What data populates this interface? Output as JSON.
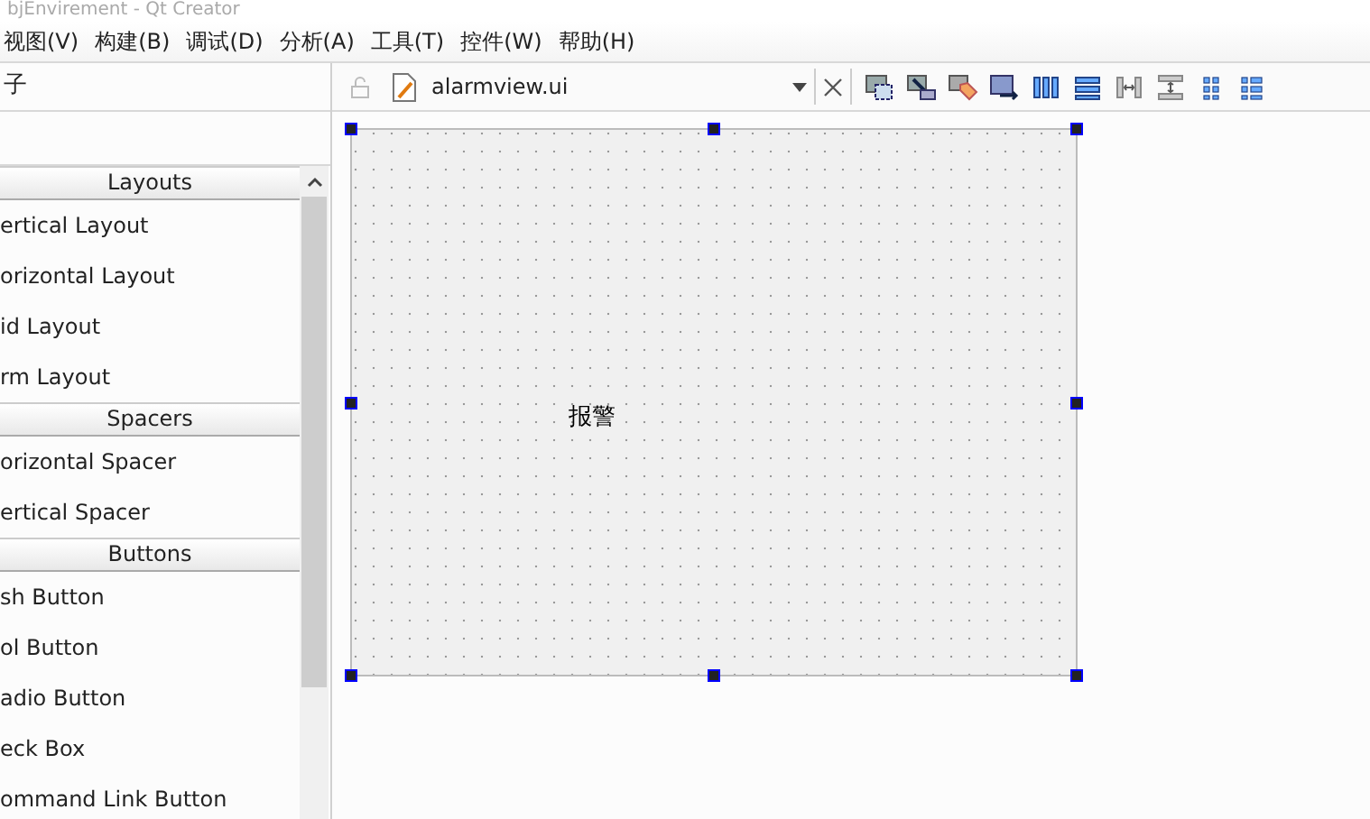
{
  "window": {
    "title": "bjEnvirement - Qt Creator"
  },
  "menu": [
    "视图(V)",
    "构建(B)",
    "调试(D)",
    "分析(A)",
    "工具(T)",
    "控件(W)",
    "帮助(H)"
  ],
  "widget_box": {
    "title": "子",
    "groups": [
      {
        "name": "Layouts",
        "items": [
          "ertical Layout",
          "orizontal Layout",
          "id Layout",
          "rm Layout"
        ]
      },
      {
        "name": "Spacers",
        "items": [
          "orizontal Spacer",
          "ertical Spacer"
        ]
      },
      {
        "name": "Buttons",
        "items": [
          "sh Button",
          "ol Button",
          "adio Button",
          "eck Box",
          "ommand Link Button"
        ]
      }
    ]
  },
  "editor": {
    "file": "alarmview.ui",
    "toolbar": [
      {
        "kind": "edit-widgets"
      },
      {
        "kind": "edit-signals"
      },
      {
        "kind": "edit-buddies"
      },
      {
        "kind": "edit-tab-order"
      },
      {
        "kind": "layout-horizontal"
      },
      {
        "kind": "layout-vertical"
      },
      {
        "kind": "split-horizontal"
      },
      {
        "kind": "split-vertical"
      },
      {
        "kind": "layout-grid"
      },
      {
        "kind": "layout-form"
      }
    ],
    "form": {
      "label": "报警"
    }
  }
}
